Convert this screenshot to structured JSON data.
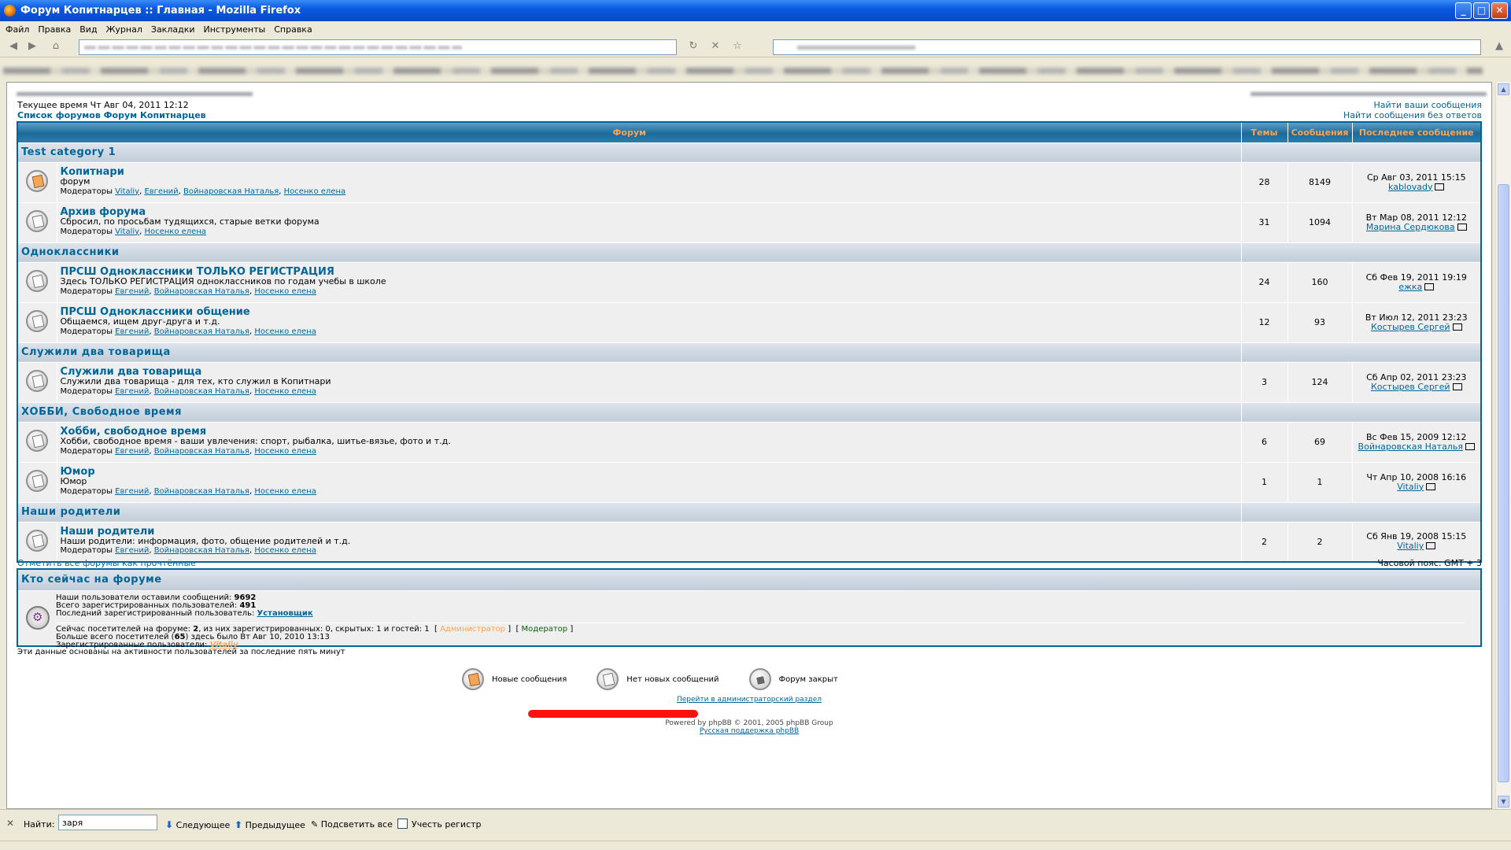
{
  "window": {
    "title": "Форум Копитнарцев :: Главная - Mozilla Firefox"
  },
  "menu": [
    "Файл",
    "Правка",
    "Вид",
    "Журнал",
    "Закладки",
    "Инструменты",
    "Справка"
  ],
  "header": {
    "current_time": "Текущее время Чт Авг 04, 2011 12:12",
    "index_link": "Список форумов Форум Копитнарцев",
    "search_own": "Найти ваши сообщения",
    "search_unanswered": "Найти сообщения без ответов"
  },
  "table": {
    "col_forum": "Форум",
    "col_topics": "Темы",
    "col_posts": "Сообщения",
    "col_last": "Последнее сообщение"
  },
  "categories": [
    {
      "name": "Test category 1",
      "forums": [
        {
          "name": "Копитнари",
          "desc": "форум",
          "mods": [
            "Vitaliy",
            "Евгений",
            "Войнаровская Наталья",
            "Носенко елена"
          ],
          "topics": "28",
          "posts": "8149",
          "last_date": "Ср Авг 03, 2011 15:15",
          "last_user": "kablovady",
          "icon": "new"
        },
        {
          "name": "Архив форума",
          "desc": "Сбросил, по просьбам тудящихся, старые ветки форума",
          "mods": [
            "Vitaliy",
            "Носенко елена"
          ],
          "topics": "31",
          "posts": "1094",
          "last_date": "Вт Мар 08, 2011 12:12",
          "last_user": "Марина Сердюкова",
          "icon": "old"
        }
      ]
    },
    {
      "name": "Одноклассники",
      "forums": [
        {
          "name": "ПРСШ Одноклассники ТОЛЬКО РЕГИСТРАЦИЯ",
          "desc": "Здесь ТОЛЬКО РЕГИСТРАЦИЯ одноклассников по годам учебы в школе",
          "mods": [
            "Евгений",
            "Войнаровская Наталья",
            "Носенко елена"
          ],
          "topics": "24",
          "posts": "160",
          "last_date": "Сб Фев 19, 2011 19:19",
          "last_user": "ежка",
          "icon": "old"
        },
        {
          "name": "ПРСШ Одноклассники общение",
          "desc": "Общаемся, ищем друг-друга и т.д.",
          "mods": [
            "Евгений",
            "Войнаровская Наталья",
            "Носенко елена"
          ],
          "topics": "12",
          "posts": "93",
          "last_date": "Вт Июл 12, 2011 23:23",
          "last_user": "Костырев Сергей",
          "icon": "old"
        }
      ]
    },
    {
      "name": "Служили два товарища",
      "forums": [
        {
          "name": "Служили два товарища",
          "desc": "Служили два товарища - для тех, кто служил в Копитнари",
          "mods": [
            "Евгений",
            "Войнаровская Наталья",
            "Носенко елена"
          ],
          "topics": "3",
          "posts": "124",
          "last_date": "Сб Апр 02, 2011 23:23",
          "last_user": "Костырев Сергей",
          "icon": "old"
        }
      ]
    },
    {
      "name": "ХОББИ, Свободное время",
      "forums": [
        {
          "name": "Хобби, свободное время",
          "desc": "Хобби, свободное время - ваши увлечения: спорт, рыбалка, шитье-вязье, фото и т.д.",
          "mods": [
            "Евгений",
            "Войнаровская Наталья",
            "Носенко елена"
          ],
          "topics": "6",
          "posts": "69",
          "last_date": "Вс Фев 15, 2009 12:12",
          "last_user": "Войнаровская Наталья",
          "icon": "old"
        },
        {
          "name": "Юмор",
          "desc": "Юмор",
          "mods": [
            "Евгений",
            "Войнаровская Наталья",
            "Носенко елена"
          ],
          "topics": "1",
          "posts": "1",
          "last_date": "Чт Апр 10, 2008 16:16",
          "last_user": "Vitaliy",
          "icon": "old"
        }
      ]
    },
    {
      "name": "Наши родители",
      "forums": [
        {
          "name": "Наши родители",
          "desc": "Наши родители: информация, фото, общение родителей и т.д.",
          "mods": [
            "Евгений",
            "Войнаровская Наталья",
            "Носенко елена"
          ],
          "topics": "2",
          "posts": "2",
          "last_date": "Сб Янв 19, 2008 15:15",
          "last_user": "Vitaliy",
          "icon": "old"
        }
      ]
    }
  ],
  "mods_label": "Модераторы",
  "mark_all": "Отметить все форумы как прочтённые",
  "timezone": "Часовой пояс: GMT + 3",
  "who": {
    "title": "Кто сейчас на форуме",
    "posts_prefix": "Наши пользователи оставили сообщений:",
    "posts_total": "9692",
    "users_prefix": "Всего зарегистрированных пользователей:",
    "users_total": "491",
    "last_user_prefix": "Последний зарегистрированный пользователь:",
    "last_user": "Установщик",
    "online_text": "Сейчас посетителей на форуме:",
    "online_count": "2",
    "online_rest": ", из них зарегистрированных: 0, скрытых: 1 и гостей: 1",
    "admin_label": "Администратор",
    "mod_label": "Модератор",
    "record_prefix": "Больше всего посетителей (",
    "record_count": "65",
    "record_suffix": ") здесь было Вт Авг 10, 2010 13:13",
    "registered_prefix": "Зарегистрированные пользователи:",
    "registered_user": "Vitaliy",
    "basis": "Эти данные основаны на активности пользователей за последние пять минут"
  },
  "legend": {
    "new": "Новые сообщения",
    "no_new": "Нет новых сообщений",
    "locked": "Форум закрыт"
  },
  "footer": {
    "admin_link": "Перейти в администраторский раздел",
    "powered": "Powered by phpBB © 2001, 2005 phpBB Group",
    "support": "Русская поддержка phpBB"
  },
  "findbar": {
    "label": "Найти:",
    "value": "заря",
    "next": "Следующее",
    "prev": "Предыдущее",
    "highlight": "Подсветить все",
    "match_case": "Учесть регистр"
  },
  "colors": {
    "link": "#006699",
    "title_blue": "#0a5ae0",
    "header_orange": "#ffa34f",
    "redact": "#ff1010"
  }
}
